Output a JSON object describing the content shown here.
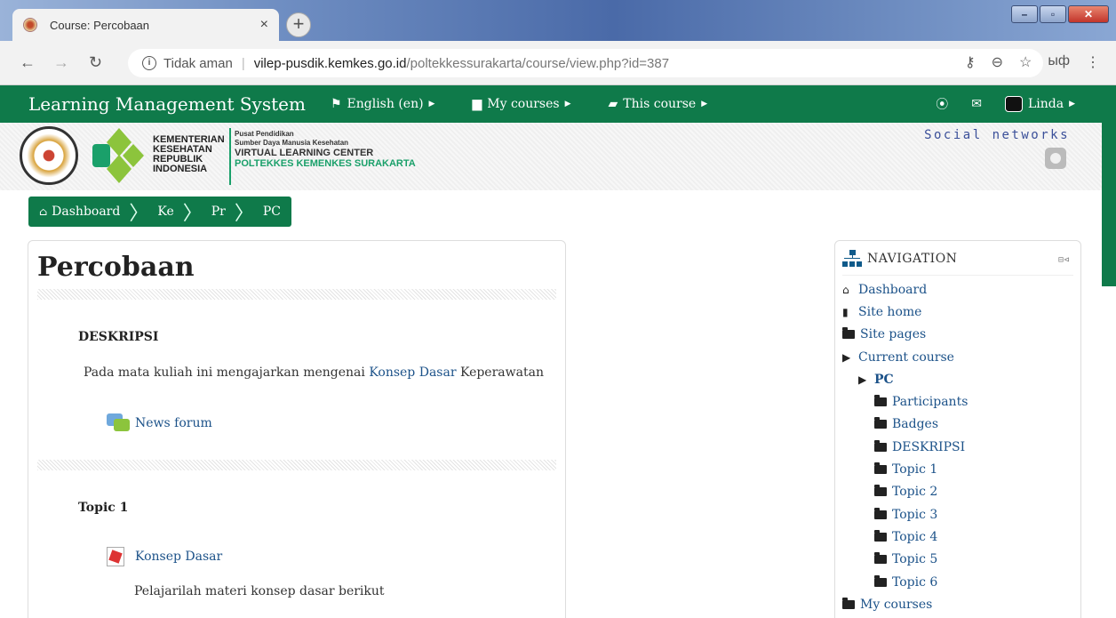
{
  "browser": {
    "tab_title": "Course: Percobaan",
    "tab_close": "×",
    "new_tab": "+",
    "security_text": "Tidak aman",
    "separator": "|",
    "url_host": "vilep-pusdik.kemkes.go.id",
    "url_path": "/poltekkessurakarta/course/view.php?id=387",
    "ext_text": "ыф"
  },
  "navbar": {
    "brand": "Learning Management System",
    "language": "English (en)",
    "my_courses": "My courses",
    "this_course": "This course",
    "user": "Linda"
  },
  "header": {
    "kementerian": [
      "KEMENTERIAN",
      "KESEHATAN",
      "REPUBLIK",
      "INDONESIA"
    ],
    "pusat_line1": "Pusat Pendidikan",
    "pusat_line2": "Sumber Daya Manusia Kesehatan",
    "vlc": "VIRTUAL LEARNING CENTER",
    "poltekkes": "POLTEKKES KEMENKES SURAKARTA",
    "social": "Social networks"
  },
  "breadcrumb": [
    "Dashboard",
    "Ke",
    "Pr",
    "PC"
  ],
  "course": {
    "title": "Percobaan",
    "section1_title": "DESKRIPSI",
    "desc_pre": "Pada mata kuliah ini mengajarkan mengenai ",
    "desc_link": "Konsep Dasar",
    "desc_post": " Keperawatan",
    "news_forum": "News forum",
    "section2_title": "Topic 1",
    "resource": "Konsep Dasar",
    "resource_desc": "Pelajarilah materi konsep dasar berikut"
  },
  "navigation": {
    "title": "NAVIGATION",
    "items": [
      {
        "label": "Dashboard",
        "level": 0,
        "icon": "home-icon"
      },
      {
        "label": "Site home",
        "level": 0,
        "icon": "file-icon"
      },
      {
        "label": "Site pages",
        "level": 0,
        "icon": "folder-icon"
      },
      {
        "label": "Current course",
        "level": 0,
        "icon": "folder-open-icon"
      },
      {
        "label": "PC",
        "level": 1,
        "icon": "folder-open-icon"
      },
      {
        "label": "Participants",
        "level": 2,
        "icon": "folder-icon"
      },
      {
        "label": "Badges",
        "level": 2,
        "icon": "folder-icon"
      },
      {
        "label": "DESKRIPSI",
        "level": 2,
        "icon": "folder-icon"
      },
      {
        "label": "Topic 1",
        "level": 2,
        "icon": "folder-icon"
      },
      {
        "label": "Topic 2",
        "level": 2,
        "icon": "folder-icon"
      },
      {
        "label": "Topic 3",
        "level": 2,
        "icon": "folder-icon"
      },
      {
        "label": "Topic 4",
        "level": 2,
        "icon": "folder-icon"
      },
      {
        "label": "Topic 5",
        "level": 2,
        "icon": "folder-icon"
      },
      {
        "label": "Topic 6",
        "level": 2,
        "icon": "folder-icon"
      },
      {
        "label": "My courses",
        "level": 0,
        "icon": "folder-icon"
      }
    ]
  },
  "colors": {
    "brand_green": "#0f7a4a",
    "link_blue": "#1c5289"
  }
}
